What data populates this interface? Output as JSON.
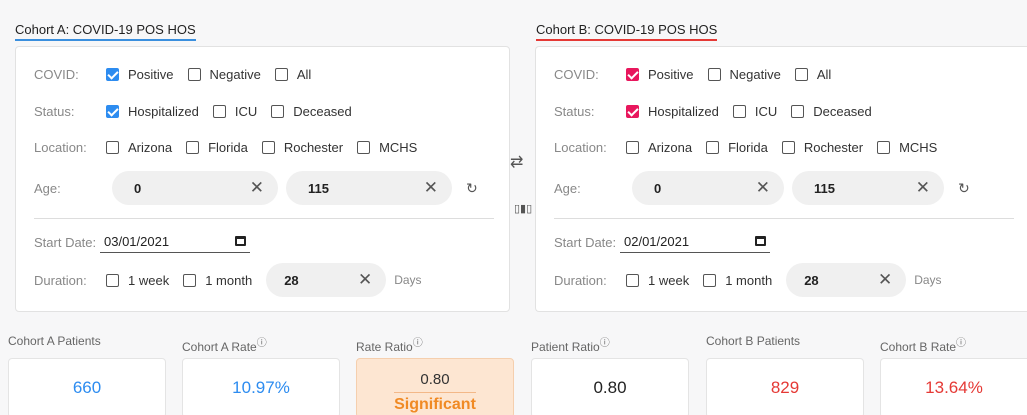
{
  "cohort_a": {
    "title": "Cohort A: COVID-19 POS HOS",
    "covid_label": "COVID:",
    "covid_options": [
      "Positive",
      "Negative",
      "All"
    ],
    "status_label": "Status:",
    "status_options": [
      "Hospitalized",
      "ICU",
      "Deceased"
    ],
    "location_label": "Location:",
    "location_options": [
      "Arizona",
      "Florida",
      "Rochester",
      "MCHS"
    ],
    "age_label": "Age:",
    "age_min": "0",
    "age_max": "115",
    "start_date_label": "Start Date:",
    "start_date": "03/01/2021",
    "duration_label": "Duration:",
    "duration_options": [
      "1 week",
      "1 month"
    ],
    "duration_value": "28",
    "duration_unit": "Days",
    "accent": "#2d8cf0"
  },
  "cohort_b": {
    "title": "Cohort B: COVID-19 POS HOS",
    "covid_label": "COVID:",
    "covid_options": [
      "Positive",
      "Negative",
      "All"
    ],
    "status_label": "Status:",
    "status_options": [
      "Hospitalized",
      "ICU",
      "Deceased"
    ],
    "location_label": "Location:",
    "location_options": [
      "Arizona",
      "Florida",
      "Rochester",
      "MCHS"
    ],
    "age_label": "Age:",
    "age_min": "0",
    "age_max": "115",
    "start_date_label": "Start Date:",
    "start_date": "02/01/2021",
    "duration_label": "Duration:",
    "duration_options": [
      "1 week",
      "1 month"
    ],
    "duration_value": "28",
    "duration_unit": "Days",
    "accent": "#e8175d"
  },
  "icons": {
    "clear": "✕",
    "reset": "↻",
    "swap": "⇄",
    "compare": "▯▮▯"
  },
  "stats": {
    "a_patients_label": "Cohort A Patients",
    "a_patients": "660",
    "a_rate_label": "Cohort A Rate",
    "a_rate": "10.97%",
    "rate_ratio_label": "Rate Ratio",
    "rate_ratio": "0.80",
    "rate_ratio_note": "Significant",
    "patient_ratio_label": "Patient Ratio",
    "patient_ratio": "0.80",
    "b_patients_label": "Cohort B Patients",
    "b_patients": "829",
    "b_rate_label": "Cohort B Rate",
    "b_rate": "13.64%",
    "info_icon": "ⓘ"
  }
}
